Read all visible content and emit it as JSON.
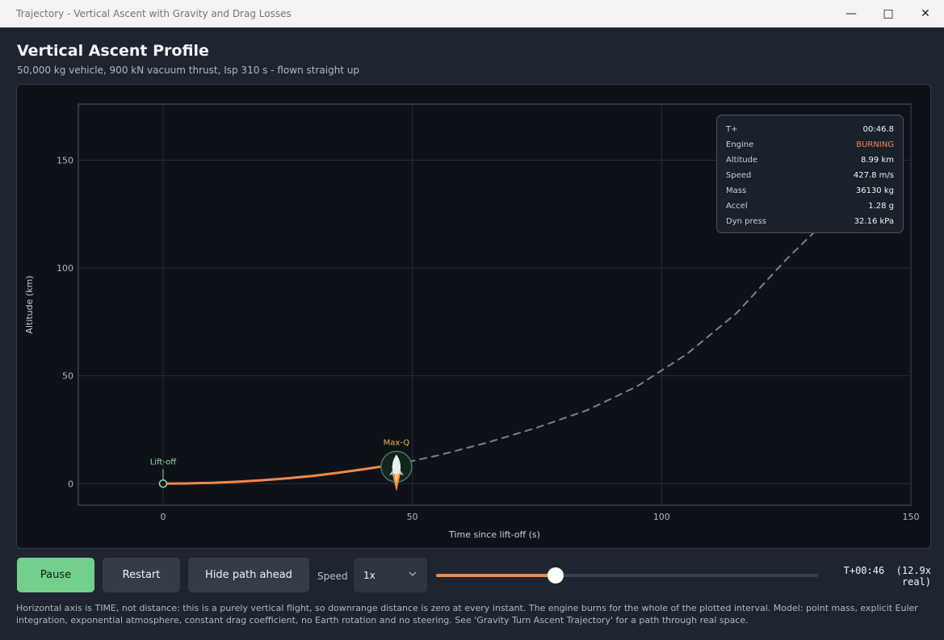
{
  "window": {
    "title": "Trajectory - Vertical Ascent with Gravity and Drag Losses"
  },
  "toolbar": {
    "icons": [
      "select-region-icon",
      "camera-icon",
      "pointer-icon",
      "frame-icon",
      "cursor-select-icon",
      "pulse-icon",
      "accessibility-icon",
      "check-icon",
      "collapse-icon"
    ]
  },
  "header": {
    "title": "Vertical Ascent Profile",
    "subtitle": "50,000 kg vehicle, 900 kN vacuum thrust, Isp 310 s - flown straight up"
  },
  "chart_data": {
    "type": "line",
    "xlabel": "Time since lift-off (s)",
    "ylabel": "Altitude (km)",
    "xlim": [
      -17,
      150
    ],
    "ylim": [
      -10,
      176
    ],
    "xticks": [
      0,
      50,
      100,
      150
    ],
    "yticks": [
      0,
      50,
      100,
      150
    ],
    "grid": true,
    "series": [
      {
        "role": "flown",
        "color": "#f08a4b",
        "x": [
          0,
          5,
          10,
          15,
          20,
          25,
          30,
          35,
          40,
          46.8
        ],
        "y": [
          0,
          0.1,
          0.4,
          0.9,
          1.6,
          2.5,
          3.6,
          5.0,
          6.6,
          8.99
        ]
      },
      {
        "role": "ahead",
        "color": "#7a7f88",
        "dashed": true,
        "x": [
          46.8,
          55,
          65,
          75,
          85,
          95,
          105,
          115,
          125,
          133
        ],
        "y": [
          8.99,
          13,
          19,
          26,
          34,
          45,
          60,
          79,
          104,
          122
        ]
      }
    ],
    "annotations": [
      {
        "label": "Lift-off",
        "x": 0,
        "y": 0,
        "color": "#8fe0a5"
      },
      {
        "label": "Max-Q",
        "x": 46.8,
        "y": 8.99,
        "color": "#f0b64b"
      }
    ]
  },
  "hud": {
    "rows": [
      {
        "key": "T+",
        "value": "00:46.8",
        "color": "#f1f3f6"
      },
      {
        "key": "Engine",
        "value": "BURNING",
        "color": "#f08a4b"
      },
      {
        "key": "Altitude",
        "value": "8.99 km",
        "color": "#f1f3f6"
      },
      {
        "key": "Speed",
        "value": "427.8 m/s",
        "color": "#f1f3f6"
      },
      {
        "key": "Mass",
        "value": "36130 kg",
        "color": "#f1f3f6"
      },
      {
        "key": "Accel",
        "value": "1.28 g",
        "color": "#f1f3f6"
      },
      {
        "key": "Dyn press",
        "value": "32.16 kPa",
        "color": "#f1f3f6"
      }
    ]
  },
  "controls": {
    "pause_label": "Pause",
    "restart_label": "Restart",
    "hide_path_label": "Hide path ahead",
    "speed_label": "Speed",
    "speed_value": "1x",
    "progress": 0.312,
    "clock_line1": "T+00:46  (12.9x",
    "clock_line2": "real)"
  },
  "footer": {
    "note": "Horizontal axis is TIME, not distance: this is a purely vertical flight, so downrange distance is zero at every instant. The engine burns for the whole of the plotted interval. Model: point mass, explicit Euler integration, exponential atmosphere, constant drag coefficient, no Earth rotation and no steering. See 'Gravity Turn Ascent Trajectory' for a path through real space."
  },
  "colors": {
    "accent": "#f08a4b",
    "go": "#72d08c",
    "panel": "#0e1118"
  }
}
